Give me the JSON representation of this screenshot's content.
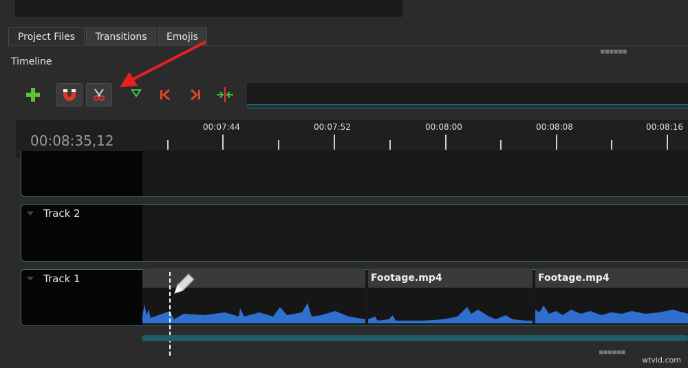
{
  "tabs": [
    {
      "label": "Project Files",
      "active": true
    },
    {
      "label": "Transitions",
      "active": false
    },
    {
      "label": "Emojis",
      "active": false
    }
  ],
  "panel_title": "Timeline",
  "toolbar": {
    "tools": [
      {
        "name": "add-track",
        "icon": "plus-icon",
        "color": "#5cc23c"
      },
      {
        "name": "snapping",
        "icon": "magnet-icon",
        "color": "#e0352b"
      },
      {
        "name": "razor",
        "icon": "scissors-icon",
        "color": "#d0d0d0"
      },
      {
        "name": "add-marker",
        "icon": "marker-icon",
        "color": "#3fbf4a"
      },
      {
        "name": "previous-marker",
        "icon": "jump-start-icon",
        "color": "#e0452b"
      },
      {
        "name": "next-marker",
        "icon": "jump-end-icon",
        "color": "#e0452b"
      },
      {
        "name": "center-playhead",
        "icon": "center-icon",
        "color": "#3fbf4a"
      }
    ]
  },
  "annotation": {
    "arrow_color": "#e82020"
  },
  "timeline": {
    "timecode": "00:08:35,12",
    "ticks": [
      "00:07:44",
      "00:07:52",
      "00:08:00",
      "00:08:08",
      "00:08:16"
    ]
  },
  "tracks": [
    {
      "name": ""
    },
    {
      "name": "Track 2"
    },
    {
      "name": "Track 1"
    }
  ],
  "clips": [
    {
      "title": ""
    },
    {
      "title": "Footage.mp4"
    },
    {
      "title": "Footage.mp4"
    }
  ],
  "watermark": "wtvid.com",
  "colors": {
    "accent_teal": "#3c6e75",
    "waveform": "#2f6fd0"
  }
}
